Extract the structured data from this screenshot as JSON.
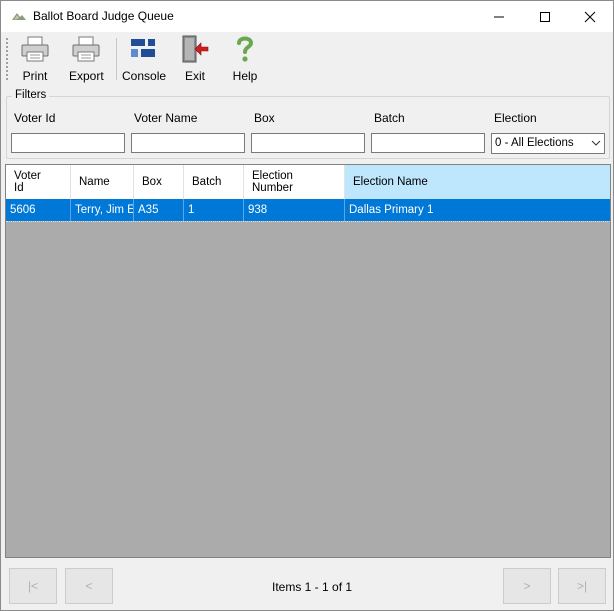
{
  "window": {
    "title": "Ballot Board Judge Queue"
  },
  "toolbar": {
    "print": "Print",
    "export": "Export",
    "console": "Console",
    "exit": "Exit",
    "help": "Help"
  },
  "filters": {
    "legend": "Filters",
    "voter_id": {
      "label": "Voter Id",
      "value": ""
    },
    "voter_name": {
      "label": "Voter Name",
      "value": ""
    },
    "box": {
      "label": "Box",
      "value": ""
    },
    "batch": {
      "label": "Batch",
      "value": ""
    },
    "election": {
      "label": "Election",
      "selected": "0 - All Elections"
    }
  },
  "grid": {
    "columns": {
      "voter_id_l1": "Voter",
      "voter_id_l2": "Id",
      "name": "Name",
      "box": "Box",
      "batch": "Batch",
      "election_number_l1": "Election",
      "election_number_l2": "Number",
      "election_name": "Election Name"
    },
    "rows": [
      {
        "voter_id": "5606",
        "name": "Terry, Jim E",
        "box": "A35",
        "batch": "1",
        "election_number": "938",
        "election_name": "Dallas Primary 1"
      }
    ]
  },
  "pager": {
    "first": "|<",
    "prev": "<",
    "next": ">",
    "last": ">|",
    "status": "Items 1 - 1 of 1"
  },
  "colors": {
    "selection": "#0078d7",
    "active_header": "#bee6fd",
    "grid_background": "#ababab",
    "console_icon": "#1f4e96",
    "exit_icon": "#cc1f1f",
    "help_icon": "#6aa84f"
  }
}
